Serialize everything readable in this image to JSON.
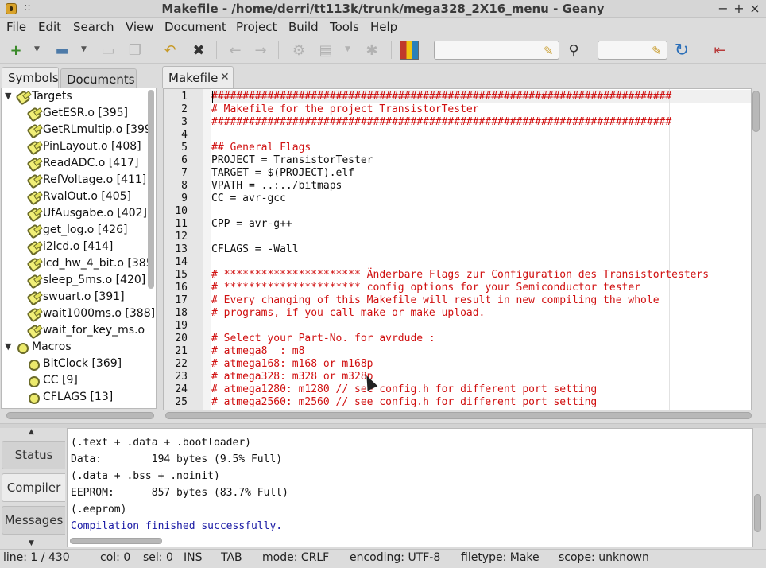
{
  "window": {
    "title": "Makefile - /home/derri/tt113k/trunk/mega328_2X16_menu - Geany"
  },
  "menu": [
    "File",
    "Edit",
    "Search",
    "View",
    "Document",
    "Project",
    "Build",
    "Tools",
    "Help"
  ],
  "toolbar": {
    "search_value": "",
    "goto_value": ""
  },
  "sidebar": {
    "tabs": [
      "Symbols",
      "Documents"
    ],
    "groups": [
      {
        "label": "Targets",
        "items": [
          "GetESR.o [395]",
          "GetRLmultip.o [399",
          "PinLayout.o [408]",
          "ReadADC.o [417]",
          "RefVoltage.o [411]",
          "RvalOut.o [405]",
          "UfAusgabe.o [402]",
          "get_log.o [426]",
          "i2lcd.o [414]",
          "lcd_hw_4_bit.o [385",
          "sleep_5ms.o [420]",
          "swuart.o [391]",
          "wait1000ms.o [388]",
          "wait_for_key_ms.o"
        ]
      },
      {
        "label": "Macros",
        "items": [
          "BitClock [369]",
          "CC [9]",
          "CFLAGS [13]"
        ]
      }
    ]
  },
  "editor": {
    "tab_label": "Makefile",
    "lines": [
      {
        "n": "1",
        "text": "##########################################################################",
        "c": true
      },
      {
        "n": "2",
        "text": "# Makefile for the project TransistorTester",
        "c": true
      },
      {
        "n": "3",
        "text": "##########################################################################",
        "c": true
      },
      {
        "n": "4",
        "text": "",
        "c": false
      },
      {
        "n": "5",
        "text": "## General Flags",
        "c": true
      },
      {
        "n": "6",
        "text": "PROJECT = TransistorTester",
        "c": false
      },
      {
        "n": "7",
        "text": "TARGET = $(PROJECT).elf",
        "c": false
      },
      {
        "n": "8",
        "text": "VPATH = ..:../bitmaps",
        "c": false
      },
      {
        "n": "9",
        "text": "CC = avr-gcc",
        "c": false
      },
      {
        "n": "10",
        "text": "",
        "c": false
      },
      {
        "n": "11",
        "text": "CPP = avr-g++",
        "c": false
      },
      {
        "n": "12",
        "text": "",
        "c": false
      },
      {
        "n": "13",
        "text": "CFLAGS = -Wall",
        "c": false
      },
      {
        "n": "14",
        "text": "",
        "c": false
      },
      {
        "n": "15",
        "text": "# ********************** Änderbare Flags zur Configuration des Transistortesters",
        "c": true
      },
      {
        "n": "16",
        "text": "# ********************** config options for your Semiconductor tester",
        "c": true
      },
      {
        "n": "17",
        "text": "# Every changing of this Makefile will result in new compiling the whole",
        "c": true
      },
      {
        "n": "18",
        "text": "# programs, if you call make or make upload.",
        "c": true
      },
      {
        "n": "19",
        "text": "",
        "c": false
      },
      {
        "n": "20",
        "text": "# Select your Part-No. for avrdude :",
        "c": true
      },
      {
        "n": "21",
        "text": "# atmega8  : m8",
        "c": true
      },
      {
        "n": "22",
        "text": "# atmega168: m168 or m168p",
        "c": true
      },
      {
        "n": "23",
        "text": "# atmega328: m328 or m328p",
        "c": true
      },
      {
        "n": "24",
        "text": "# atmega1280: m1280 // see config.h for different port setting",
        "c": true
      },
      {
        "n": "25",
        "text": "# atmega2560: m2560 // see config.h for different port setting",
        "c": true
      }
    ]
  },
  "messages": {
    "tabs": [
      "Status",
      "Compiler",
      "Messages"
    ],
    "lines": [
      {
        "text": "(.text + .data + .bootloader)",
        "ok": false
      },
      {
        "text": "Data:        194 bytes (9.5% Full)",
        "ok": false
      },
      {
        "text": "(.data + .bss + .noinit)",
        "ok": false
      },
      {
        "text": "EEPROM:      857 bytes (83.7% Full)",
        "ok": false
      },
      {
        "text": "(.eeprom)",
        "ok": false
      },
      {
        "text": "Compilation finished successfully.",
        "ok": true
      }
    ]
  },
  "statusbar": {
    "line": "line: 1 / 430",
    "col": "col: 0",
    "sel": "sel: 0",
    "ins": "INS",
    "tab": "TAB",
    "mode": "mode: CRLF",
    "encoding": "encoding: UTF-8",
    "filetype": "filetype: Make",
    "scope": "scope: unknown"
  },
  "colors": {
    "comment": "#d01010",
    "success": "#1a1aa5",
    "gutter": "#e6e6e6"
  },
  "icons": [
    "new-file-icon",
    "open-folder-icon",
    "save-icon",
    "save-all-icon",
    "revert-icon",
    "close-file-icon",
    "back-icon",
    "forward-icon",
    "compile-icon",
    "build-icon",
    "run-icon",
    "color-chooser-icon",
    "clear-icon",
    "find-icon",
    "jump-to-line-icon",
    "quit-icon"
  ]
}
